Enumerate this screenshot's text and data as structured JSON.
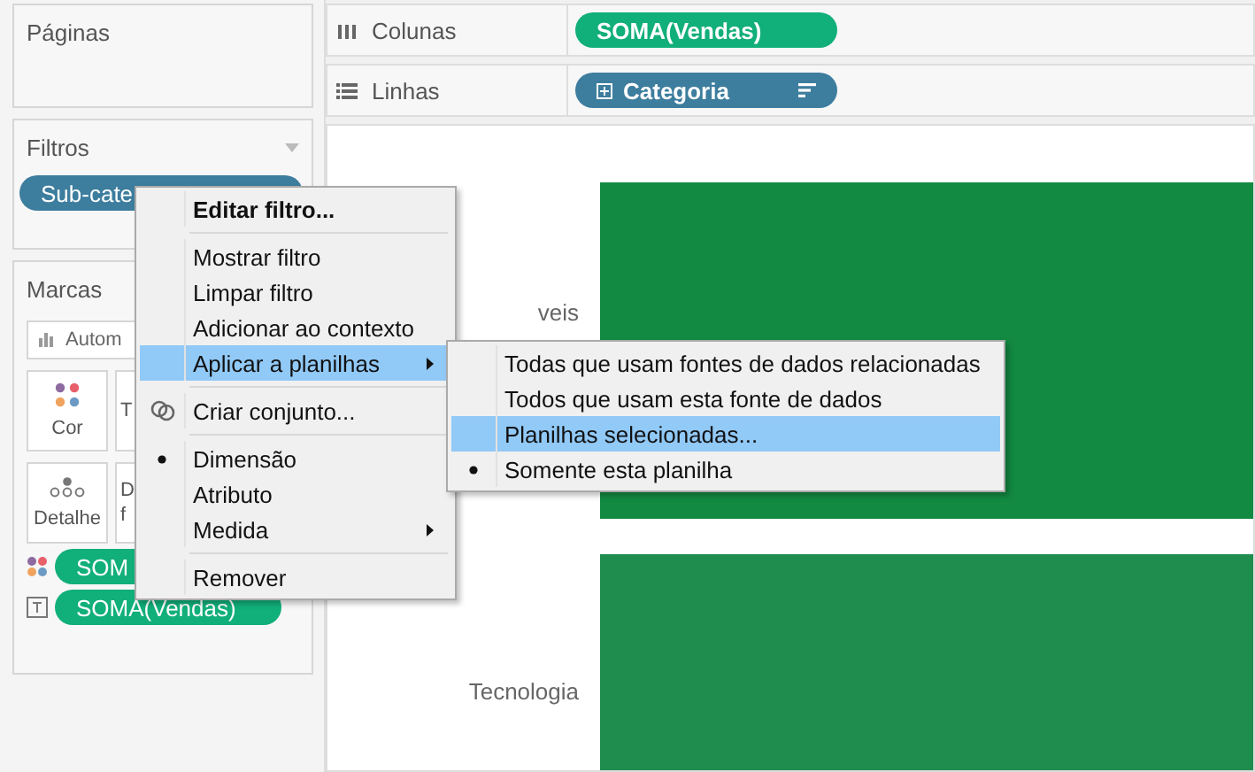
{
  "left_panel": {
    "pages_card": {
      "title": "Páginas"
    },
    "filters_card": {
      "title": "Filtros",
      "pills": [
        {
          "label": "Sub-cate",
          "kind": "dimension"
        }
      ]
    },
    "marks_card": {
      "title": "Marcas",
      "mark_type": "Autom",
      "tiles": [
        {
          "label": "Cor",
          "kind": "color"
        },
        {
          "label": "T",
          "kind": "size"
        },
        {
          "label": "Detalhe",
          "kind": "detail"
        },
        {
          "label": "D f",
          "kind": "tooltip"
        }
      ],
      "pills": [
        {
          "label": "SOM",
          "kind": "color"
        },
        {
          "label": "SOMA(Vendas)",
          "kind": "text"
        }
      ]
    }
  },
  "shelves": [
    {
      "label": "Colunas",
      "kind": "columns",
      "pills": [
        {
          "label": "SOMA(Vendas)",
          "kind": "measure"
        }
      ]
    },
    {
      "label": "Linhas",
      "kind": "rows",
      "pills": [
        {
          "label": "Categoria",
          "kind": "dimension"
        }
      ]
    }
  ],
  "view": {
    "rows": [
      {
        "header": "veis"
      },
      {
        "header": "Tecnologia"
      }
    ]
  },
  "context_menu": {
    "items": [
      {
        "kind": "default",
        "label": "Editar filtro...",
        "selected": false
      },
      {
        "kind": "separator"
      },
      {
        "kind": "item",
        "label": "Mostrar filtro",
        "selected": false
      },
      {
        "kind": "item",
        "label": "Limpar filtro",
        "selected": false
      },
      {
        "kind": "item",
        "label": "Adicionar ao contexto",
        "selected": false
      },
      {
        "kind": "submenu",
        "label": "Aplicar a planilhas",
        "selected": true
      },
      {
        "kind": "separator"
      },
      {
        "kind": "icon",
        "label": "Criar conjunto...",
        "selected": false
      },
      {
        "kind": "separator"
      },
      {
        "kind": "item",
        "label": "Dimensão",
        "selected": false,
        "checked": true
      },
      {
        "kind": "item",
        "label": "Atributo",
        "selected": false,
        "checked": false
      },
      {
        "kind": "submenu",
        "label": "Medida",
        "selected": false
      },
      {
        "kind": "separator"
      },
      {
        "kind": "item",
        "label": "Remover",
        "selected": false
      }
    ]
  },
  "submenu": {
    "items": [
      {
        "label": "Todas que usam fontes de dados relacionadas",
        "selected": false,
        "checked": false
      },
      {
        "label": "Todos que usam esta fonte de dados",
        "selected": false,
        "checked": false
      },
      {
        "label": "Planilhas selecionadas...",
        "selected": true,
        "checked": false
      },
      {
        "label": "Somente esta planilha",
        "selected": false,
        "checked": true
      }
    ]
  }
}
